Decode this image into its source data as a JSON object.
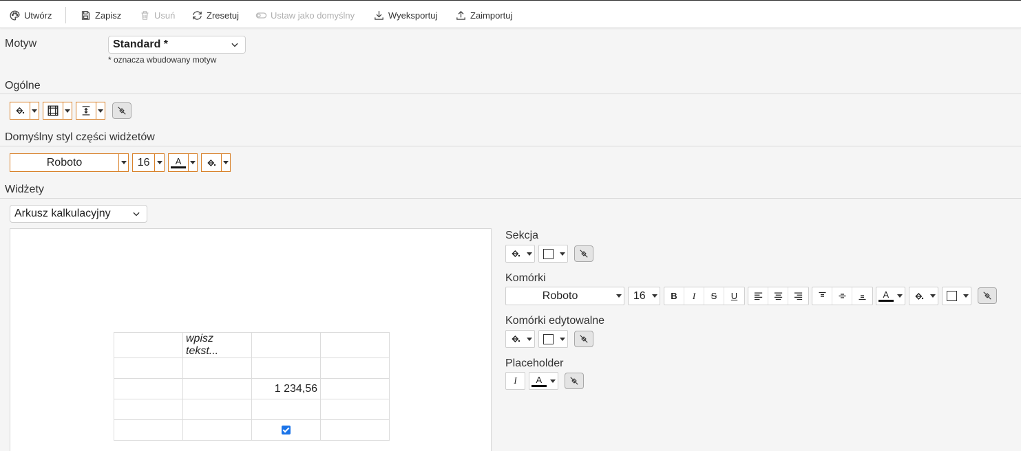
{
  "toolbar": {
    "create": "Utwórz",
    "save": "Zapisz",
    "delete": "Usuń",
    "reset": "Zresetuj",
    "set_default": "Ustaw jako domyślny",
    "export": "Wyeksportuj",
    "import": "Zaimportuj"
  },
  "theme": {
    "label": "Motyw",
    "selected": "Standard *",
    "hint": "* oznacza wbudowany motyw"
  },
  "sections": {
    "general": "Ogólne",
    "default_style": "Domyślny styl części widżetów",
    "widgets": "Widżety"
  },
  "default_style": {
    "font": "Roboto",
    "size": "16"
  },
  "widget_select": {
    "selected": "Arkusz kalkulacyjny"
  },
  "sheet": {
    "rows": [
      [
        "",
        "wpisz tekst...",
        "",
        ""
      ],
      [
        "",
        "",
        "",
        ""
      ],
      [
        "",
        "",
        "1 234,56",
        ""
      ],
      [
        "",
        "",
        "",
        ""
      ],
      [
        "",
        "",
        "",
        ""
      ]
    ],
    "checkbox_checked": true
  },
  "props": {
    "section": "Sekcja",
    "cells": "Komórki",
    "editable_cells": "Komórki edytowalne",
    "placeholder": "Placeholder",
    "cells_font": "Roboto",
    "cells_size": "16"
  },
  "colors": {
    "accent_border": "#d9822b",
    "checkbox": "#1a73e8"
  }
}
